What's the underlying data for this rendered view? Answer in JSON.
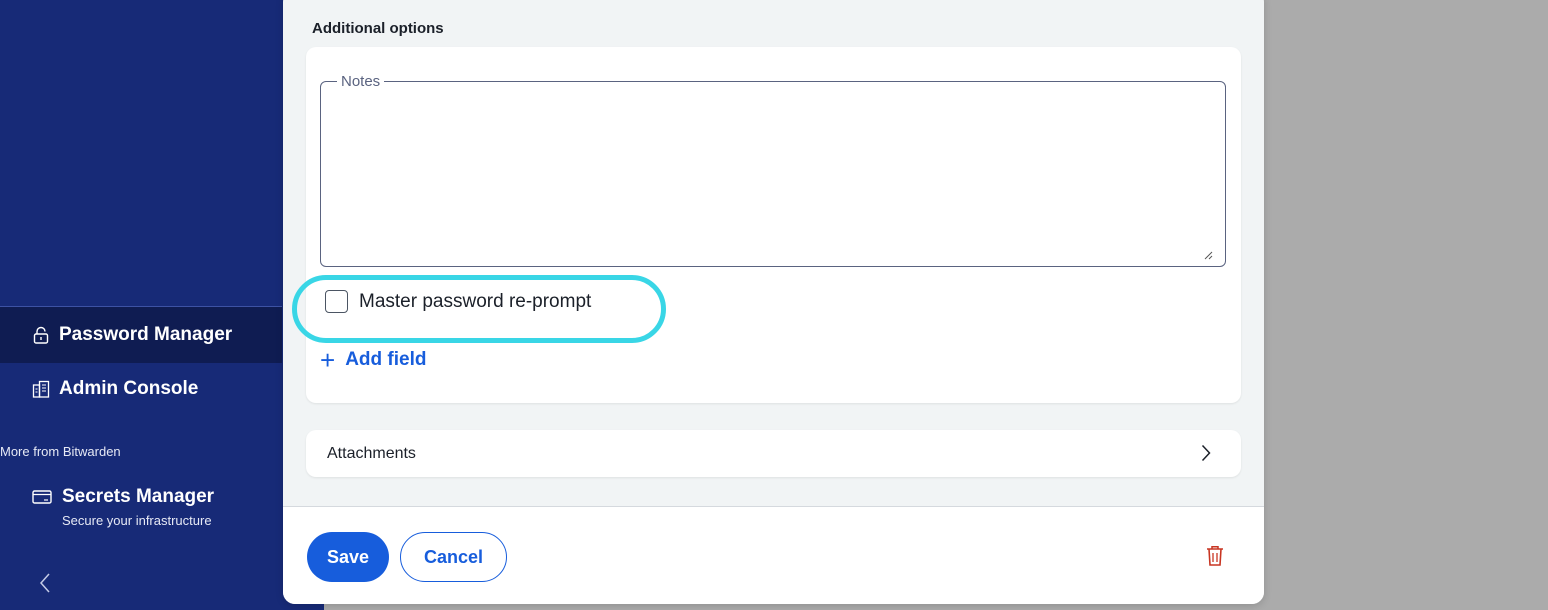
{
  "sidebar": {
    "items": [
      {
        "label": "Password Manager",
        "icon": "lock-icon",
        "active": true
      },
      {
        "label": "Admin Console",
        "icon": "building-icon",
        "active": false
      }
    ],
    "more_label": "More from Bitwarden",
    "secrets": {
      "label": "Secrets Manager",
      "subtitle": "Secure your infrastructure",
      "icon": "window-icon"
    },
    "collapse_icon": "chevron-left-icon"
  },
  "dialog": {
    "section_title": "Additional options",
    "notes": {
      "legend": "Notes",
      "value": ""
    },
    "reprompt": {
      "label": "Master password re-prompt",
      "checked": false,
      "highlight_color": "#39d6e6"
    },
    "add_field": {
      "label": "Add field",
      "icon": "plus-icon"
    },
    "attachments": {
      "label": "Attachments",
      "icon": "chevron-right-icon"
    },
    "footer": {
      "save_label": "Save",
      "cancel_label": "Cancel",
      "delete_icon": "trash-icon"
    }
  },
  "colors": {
    "sidebar_bg": "#172a77",
    "sidebar_active": "#0f1c52",
    "primary": "#175ddc",
    "danger": "#c83522"
  }
}
